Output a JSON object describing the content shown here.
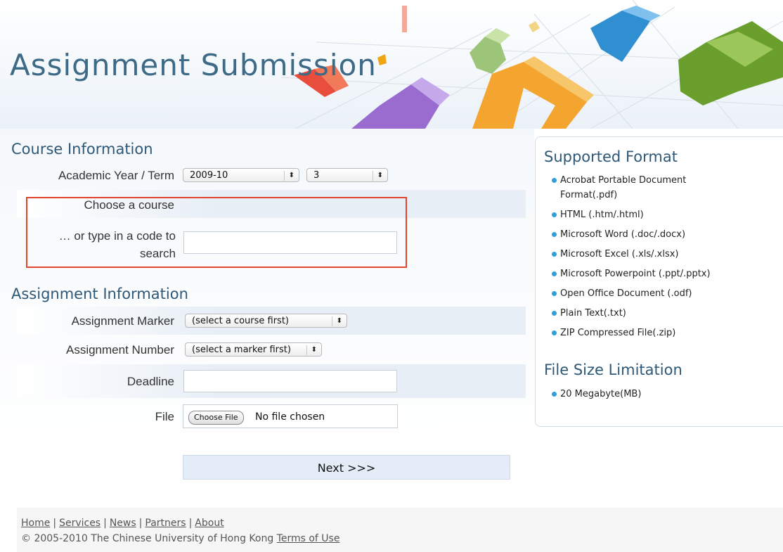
{
  "header": {
    "title": "Assignment Submission"
  },
  "course_info": {
    "heading": "Course Information",
    "year_term_label": "Academic Year / Term",
    "year_value": "2009-10",
    "term_value": "3",
    "choose_course_label": "Choose a course",
    "search_label": "… or type in a code to search",
    "search_value": ""
  },
  "assignment_info": {
    "heading": "Assignment Information",
    "marker_label": "Assignment Marker",
    "marker_value": "(select a course first)",
    "number_label": "Assignment Number",
    "number_value": "(select a marker first)",
    "deadline_label": "Deadline",
    "deadline_value": "",
    "file_label": "File",
    "file_button": "Choose File",
    "file_status": "No file chosen"
  },
  "next_button": "Next >>>",
  "sidebar": {
    "supported_heading": "Supported Format",
    "formats": [
      "Acrobat Portable Document Format(.pdf)",
      "HTML (.htm/.html)",
      "Microsoft Word (.doc/.docx)",
      "Microsoft Excel (.xls/.xlsx)",
      "Microsoft Powerpoint (.ppt/.pptx)",
      "Open Office Document (.odf)",
      "Plain Text(.txt)",
      "ZIP Compressed File(.zip)"
    ],
    "size_heading": "File Size Limitation",
    "sizes": [
      "20 Megabyte(MB)"
    ]
  },
  "footer": {
    "links": [
      "Home",
      "Services",
      "News",
      "Partners",
      "About"
    ],
    "separator": "|",
    "copyright": "© 2005-2010 The Chinese University of Hong Kong",
    "terms": "Terms of Use"
  },
  "colors": {
    "title": "#3d6a86",
    "heading": "#2f5876",
    "bullet": "#2d9fd6",
    "highlight": "#e2452d",
    "button_bg": "#e4edf7"
  }
}
